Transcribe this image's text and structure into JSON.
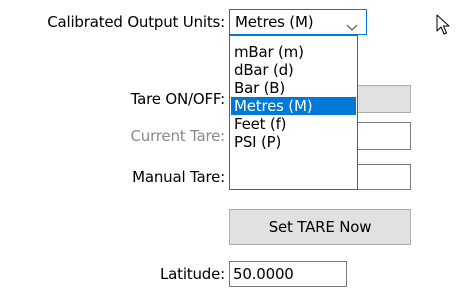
{
  "form": {
    "units_label": "Calibrated Output Units:",
    "units_selected": "Metres (M)",
    "tare_toggle_label": "Tare ON/OFF:",
    "current_tare_label": "Current Tare:",
    "manual_tare_label": "Manual Tare:",
    "set_tare_button": "Set TARE Now",
    "latitude_label": "Latitude:",
    "latitude_value": "50.0000"
  },
  "units_dropdown": {
    "options": [
      "mBar (m)",
      "dBar (d)",
      "Bar (B)",
      "Metres (M)",
      "Feet (f)",
      "PSI (P)"
    ],
    "selected_index": 3
  },
  "colors": {
    "accent": "#0078d7",
    "disabled_text": "#8a8a8a",
    "button_bg": "#e1e1e1"
  },
  "icons": {
    "dropdown": "chevron-down-icon",
    "pointer": "mouse-pointer-icon"
  }
}
